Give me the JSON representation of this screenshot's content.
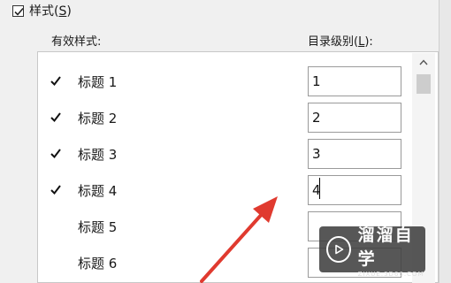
{
  "styles_option": {
    "label": "样式(S)",
    "prefix": "样式(",
    "key": "S",
    "suffix": ")",
    "checked": true
  },
  "headers": {
    "available_styles": "有效样式:",
    "toc_level": "目录级别(L):",
    "toc_prefix": "目录级别(",
    "toc_key": "L",
    "toc_suffix": "):"
  },
  "rows": [
    {
      "label": "标题 1",
      "checked": true,
      "level": "1"
    },
    {
      "label": "标题 2",
      "checked": true,
      "level": "2"
    },
    {
      "label": "标题 3",
      "checked": true,
      "level": "3"
    },
    {
      "label": "标题 4",
      "checked": true,
      "level": "4"
    },
    {
      "label": "标题 5",
      "checked": false,
      "level": ""
    },
    {
      "label": "标题 6",
      "checked": false,
      "level": ""
    }
  ],
  "watermark": {
    "title": "溜溜自学",
    "subtitle": "ZIXUE.3D66.COM"
  },
  "colors": {
    "arrow": "#e03a2f",
    "watermark_bg": "#404040"
  },
  "icons": [
    "checkbox-icon",
    "checkmark-icon",
    "scroll-up-arrow-icon",
    "red-arrow-annotation",
    "play-logo-icon"
  ]
}
